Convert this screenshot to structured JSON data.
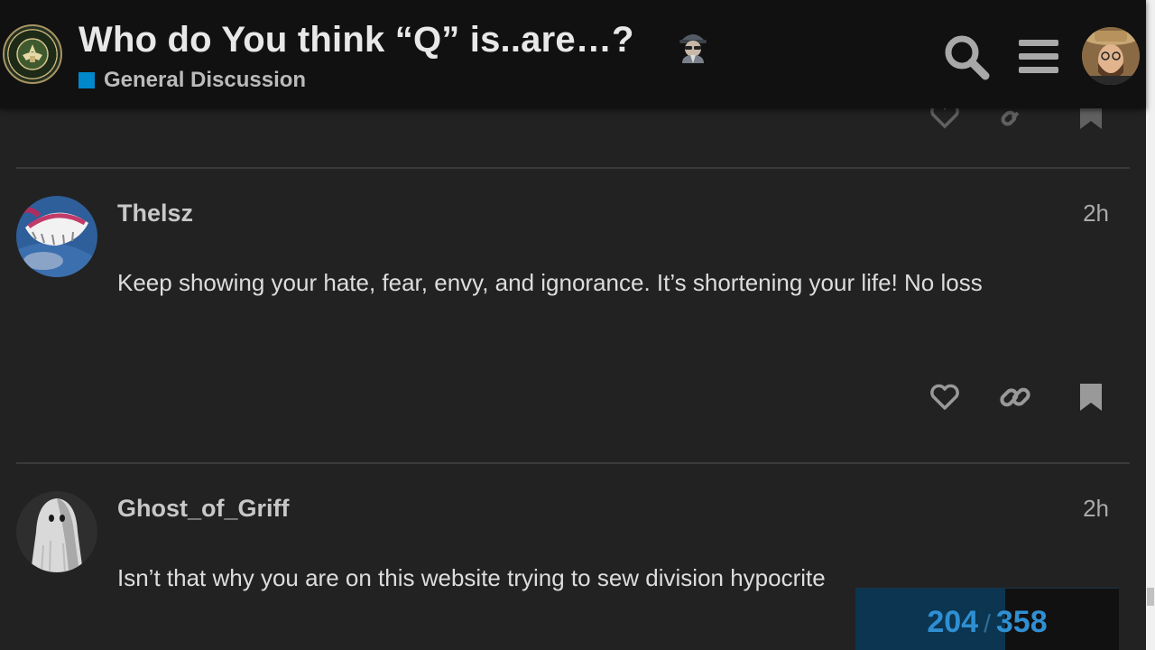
{
  "header": {
    "topic_title": "Who do You think “Q” is..are…?",
    "title_emoji_icon": "detective-emoji-icon",
    "category": {
      "name": "General Discussion",
      "color": "#0088cc"
    },
    "logo_icon": "army-seal-logo-icon",
    "search_icon": "search-icon",
    "menu_icon": "hamburger-menu-icon",
    "user_avatar": "user-avatar"
  },
  "posts": [
    {
      "username": "Thelsz",
      "time": "2h",
      "text": "Keep showing your hate, fear, envy, and ignorance. It’s shortening your life! No loss",
      "actions": [
        "heart-icon",
        "link-icon",
        "bookmark-icon"
      ]
    },
    {
      "username": "Ghost_of_Griff",
      "time": "2h",
      "text": "Isn’t that why you are on this website trying to sew division hypocrite"
    }
  ],
  "progress": {
    "current": "204",
    "separator": "/",
    "total": "358",
    "fraction": 0.57
  },
  "colors": {
    "background": "#222222",
    "header": "#111111",
    "accent": "#0088cc",
    "progress_text": "#2f8fd3"
  }
}
